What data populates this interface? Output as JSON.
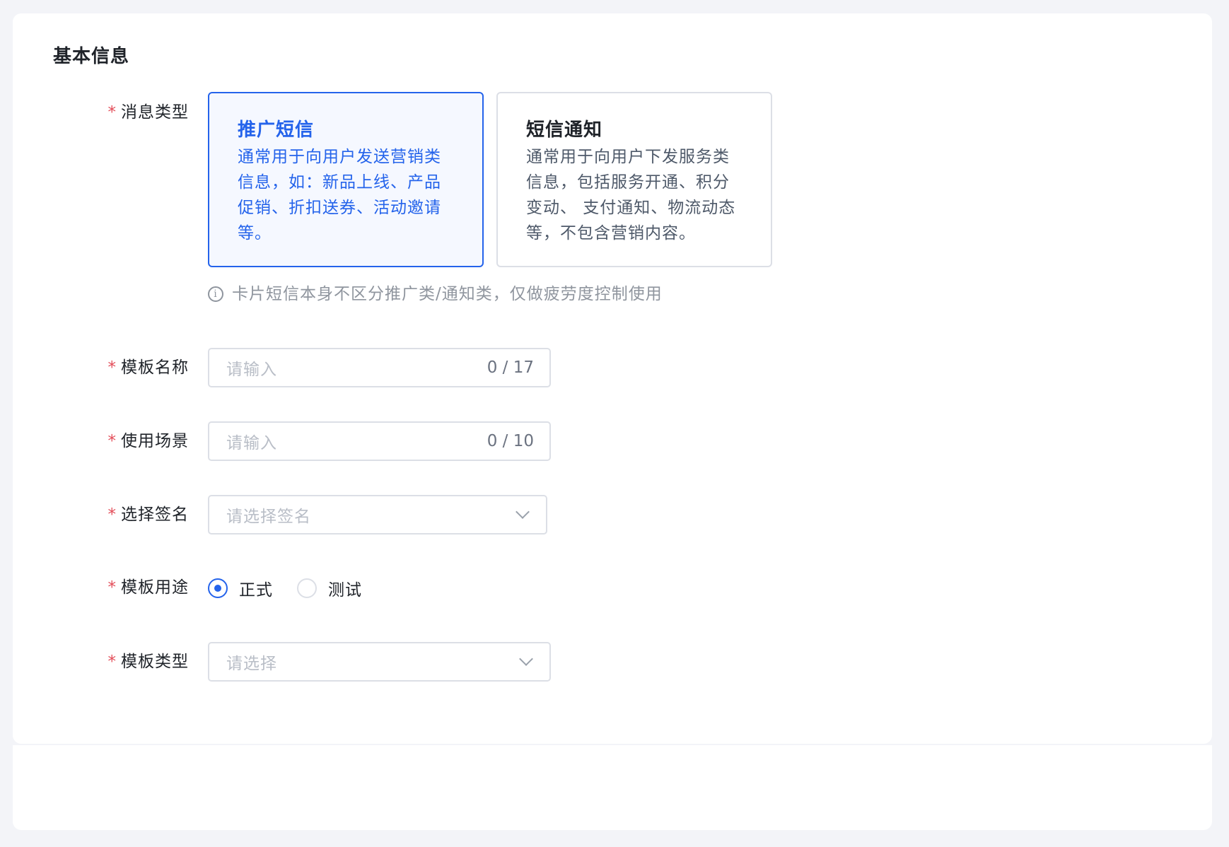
{
  "section": {
    "title": "基本信息"
  },
  "form": {
    "required_mark": "*",
    "message_type": {
      "label": "消息类型",
      "options": [
        {
          "title": "推广短信",
          "desc_lines": [
            "通常用于向用户发送营销类",
            "信息，如：新品上线、产品",
            "促销、折扣送券、活动邀请",
            "等。"
          ],
          "selected": true
        },
        {
          "title": "短信通知",
          "desc_lines": [
            "通常用于向用户下发服务类",
            "信息，包括服务开通、积分",
            "变动、 支付通知、物流动态",
            "等，不包含营销内容。"
          ],
          "selected": false
        }
      ],
      "hint": "卡片短信本身不区分推广类/通知类，仅做疲劳度控制使用",
      "hint_icon": "info-circle-icon"
    },
    "template_name": {
      "label": "模板名称",
      "placeholder": "请输入",
      "counter": "0 / 17"
    },
    "usage_scene": {
      "label": "使用场景",
      "placeholder": "请输入",
      "counter": "0 / 10"
    },
    "signature": {
      "label": "选择签名",
      "placeholder": "请选择签名",
      "icon": "chevron-down-icon"
    },
    "template_purpose": {
      "label": "模板用途",
      "options": [
        {
          "label": "正式",
          "checked": true
        },
        {
          "label": "测试",
          "checked": false
        }
      ]
    },
    "template_type": {
      "label": "模板类型",
      "placeholder": "请选择",
      "icon": "chevron-down-icon"
    }
  },
  "colors": {
    "accent": "#2463eb",
    "required": "#e34d59",
    "background": "#f3f4f8",
    "border": "#dcdfe6",
    "placeholder": "#b9bec7",
    "hint": "#8f959e"
  }
}
